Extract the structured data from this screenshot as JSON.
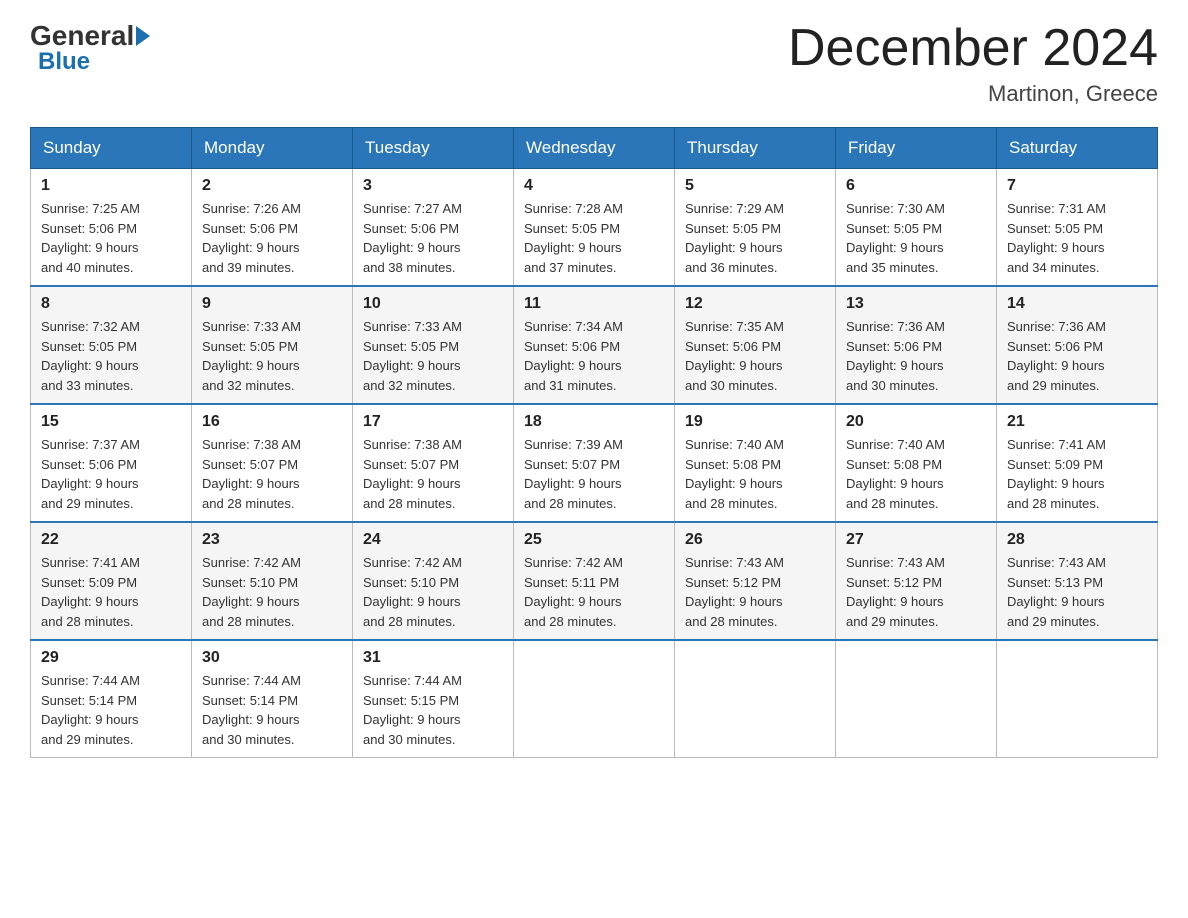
{
  "header": {
    "logo_general": "General",
    "logo_blue": "Blue",
    "month_title": "December 2024",
    "location": "Martinon, Greece"
  },
  "days_of_week": [
    "Sunday",
    "Monday",
    "Tuesday",
    "Wednesday",
    "Thursday",
    "Friday",
    "Saturday"
  ],
  "weeks": [
    [
      {
        "day": "1",
        "sunrise": "7:25 AM",
        "sunset": "5:06 PM",
        "daylight": "9 hours and 40 minutes."
      },
      {
        "day": "2",
        "sunrise": "7:26 AM",
        "sunset": "5:06 PM",
        "daylight": "9 hours and 39 minutes."
      },
      {
        "day": "3",
        "sunrise": "7:27 AM",
        "sunset": "5:06 PM",
        "daylight": "9 hours and 38 minutes."
      },
      {
        "day": "4",
        "sunrise": "7:28 AM",
        "sunset": "5:05 PM",
        "daylight": "9 hours and 37 minutes."
      },
      {
        "day": "5",
        "sunrise": "7:29 AM",
        "sunset": "5:05 PM",
        "daylight": "9 hours and 36 minutes."
      },
      {
        "day": "6",
        "sunrise": "7:30 AM",
        "sunset": "5:05 PM",
        "daylight": "9 hours and 35 minutes."
      },
      {
        "day": "7",
        "sunrise": "7:31 AM",
        "sunset": "5:05 PM",
        "daylight": "9 hours and 34 minutes."
      }
    ],
    [
      {
        "day": "8",
        "sunrise": "7:32 AM",
        "sunset": "5:05 PM",
        "daylight": "9 hours and 33 minutes."
      },
      {
        "day": "9",
        "sunrise": "7:33 AM",
        "sunset": "5:05 PM",
        "daylight": "9 hours and 32 minutes."
      },
      {
        "day": "10",
        "sunrise": "7:33 AM",
        "sunset": "5:05 PM",
        "daylight": "9 hours and 32 minutes."
      },
      {
        "day": "11",
        "sunrise": "7:34 AM",
        "sunset": "5:06 PM",
        "daylight": "9 hours and 31 minutes."
      },
      {
        "day": "12",
        "sunrise": "7:35 AM",
        "sunset": "5:06 PM",
        "daylight": "9 hours and 30 minutes."
      },
      {
        "day": "13",
        "sunrise": "7:36 AM",
        "sunset": "5:06 PM",
        "daylight": "9 hours and 30 minutes."
      },
      {
        "day": "14",
        "sunrise": "7:36 AM",
        "sunset": "5:06 PM",
        "daylight": "9 hours and 29 minutes."
      }
    ],
    [
      {
        "day": "15",
        "sunrise": "7:37 AM",
        "sunset": "5:06 PM",
        "daylight": "9 hours and 29 minutes."
      },
      {
        "day": "16",
        "sunrise": "7:38 AM",
        "sunset": "5:07 PM",
        "daylight": "9 hours and 28 minutes."
      },
      {
        "day": "17",
        "sunrise": "7:38 AM",
        "sunset": "5:07 PM",
        "daylight": "9 hours and 28 minutes."
      },
      {
        "day": "18",
        "sunrise": "7:39 AM",
        "sunset": "5:07 PM",
        "daylight": "9 hours and 28 minutes."
      },
      {
        "day": "19",
        "sunrise": "7:40 AM",
        "sunset": "5:08 PM",
        "daylight": "9 hours and 28 minutes."
      },
      {
        "day": "20",
        "sunrise": "7:40 AM",
        "sunset": "5:08 PM",
        "daylight": "9 hours and 28 minutes."
      },
      {
        "day": "21",
        "sunrise": "7:41 AM",
        "sunset": "5:09 PM",
        "daylight": "9 hours and 28 minutes."
      }
    ],
    [
      {
        "day": "22",
        "sunrise": "7:41 AM",
        "sunset": "5:09 PM",
        "daylight": "9 hours and 28 minutes."
      },
      {
        "day": "23",
        "sunrise": "7:42 AM",
        "sunset": "5:10 PM",
        "daylight": "9 hours and 28 minutes."
      },
      {
        "day": "24",
        "sunrise": "7:42 AM",
        "sunset": "5:10 PM",
        "daylight": "9 hours and 28 minutes."
      },
      {
        "day": "25",
        "sunrise": "7:42 AM",
        "sunset": "5:11 PM",
        "daylight": "9 hours and 28 minutes."
      },
      {
        "day": "26",
        "sunrise": "7:43 AM",
        "sunset": "5:12 PM",
        "daylight": "9 hours and 28 minutes."
      },
      {
        "day": "27",
        "sunrise": "7:43 AM",
        "sunset": "5:12 PM",
        "daylight": "9 hours and 29 minutes."
      },
      {
        "day": "28",
        "sunrise": "7:43 AM",
        "sunset": "5:13 PM",
        "daylight": "9 hours and 29 minutes."
      }
    ],
    [
      {
        "day": "29",
        "sunrise": "7:44 AM",
        "sunset": "5:14 PM",
        "daylight": "9 hours and 29 minutes."
      },
      {
        "day": "30",
        "sunrise": "7:44 AM",
        "sunset": "5:14 PM",
        "daylight": "9 hours and 30 minutes."
      },
      {
        "day": "31",
        "sunrise": "7:44 AM",
        "sunset": "5:15 PM",
        "daylight": "9 hours and 30 minutes."
      },
      null,
      null,
      null,
      null
    ]
  ],
  "labels": {
    "sunrise_prefix": "Sunrise: ",
    "sunset_prefix": "Sunset: ",
    "daylight_prefix": "Daylight: "
  }
}
